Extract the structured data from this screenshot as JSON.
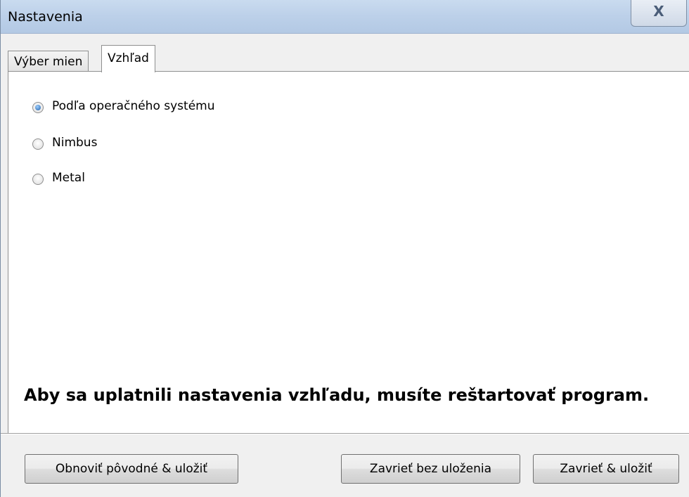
{
  "window": {
    "title": "Nastavenia",
    "close_label": "X"
  },
  "tabs": [
    {
      "label": "Výber mien",
      "active": false
    },
    {
      "label": "Vzhľad",
      "active": true
    }
  ],
  "appearance": {
    "options": [
      {
        "label": "Podľa operačného systému",
        "selected": true
      },
      {
        "label": "Nimbus",
        "selected": false
      },
      {
        "label": "Metal",
        "selected": false
      }
    ],
    "restart_notice": "Aby sa uplatnili nastavenia vzhľadu, musíte reštartovať program."
  },
  "buttons": {
    "reset_save": "Obnoviť pôvodné & uložiť",
    "close_no_save": "Zavrieť bez uloženia",
    "close_save": "Zavrieť & uložiť"
  },
  "colors": {
    "accent": "#1f5ea8",
    "titlebar": "#bcd0e9"
  }
}
